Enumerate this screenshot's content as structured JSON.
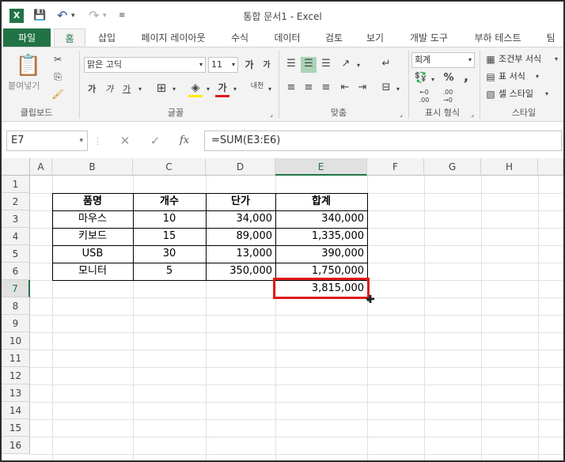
{
  "window": {
    "title": "통합 문서1 - Excel",
    "app_logo": "X"
  },
  "qat": {
    "save_icon": "💾",
    "undo_icon": "↶",
    "redo_icon": "↷",
    "customize_icon": "≡"
  },
  "tabs": [
    "파일",
    "홈",
    "삽입",
    "페이지 레이아웃",
    "수식",
    "데이터",
    "검토",
    "보기",
    "개발 도구",
    "부하 테스트",
    "팀"
  ],
  "ribbon": {
    "clipboard": {
      "paste": "붙여넣기",
      "label": "클립보드"
    },
    "font": {
      "name": "맑은 고딕",
      "size": "11",
      "label": "글꼴",
      "bold": "가",
      "italic": "가",
      "underline": "가",
      "grow": "가",
      "shrink": "가",
      "color_a": "가",
      "phonetic": "내천"
    },
    "align": {
      "label": "맞춤"
    },
    "number": {
      "format": "회계",
      "percent": "%",
      "comma": ",",
      "label": "표시 형식"
    },
    "styles": {
      "conditional": "조건부 서식",
      "table": "표 서식",
      "cell": "셀 스타일",
      "label": "스타일"
    }
  },
  "formula_bar": {
    "name_box": "E7",
    "fx": "fx",
    "formula": "=SUM(E3:E6)"
  },
  "columns": [
    "A",
    "B",
    "C",
    "D",
    "E",
    "F",
    "G",
    "H"
  ],
  "rows": [
    "1",
    "2",
    "3",
    "4",
    "5",
    "6",
    "7",
    "8",
    "9",
    "10",
    "11",
    "12",
    "13",
    "14",
    "15",
    "16"
  ],
  "table": {
    "headers": [
      "품명",
      "개수",
      "단가",
      "합계"
    ],
    "rows": [
      [
        "마우스",
        "10",
        "34,000",
        "340,000"
      ],
      [
        "키보드",
        "15",
        "89,000",
        "1,335,000"
      ],
      [
        "USB",
        "30",
        "13,000",
        "390,000"
      ],
      [
        "모니터",
        "5",
        "350,000",
        "1,750,000"
      ]
    ],
    "total": "3,815,000"
  },
  "selected_cell": "E7",
  "colors": {
    "accent": "#217346",
    "selection_outline": "#e01b1b"
  }
}
